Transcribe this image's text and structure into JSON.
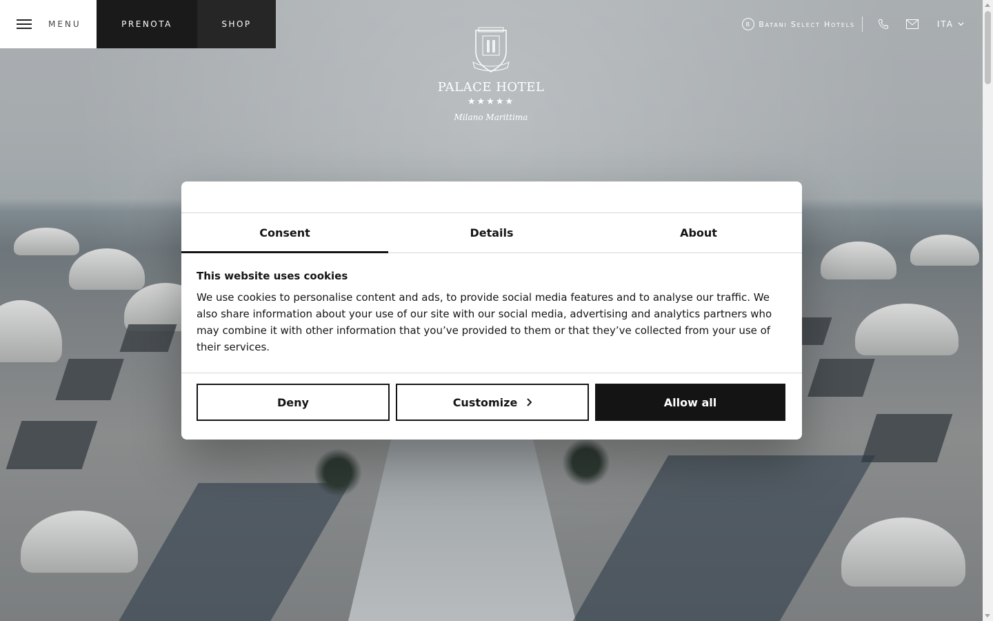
{
  "nav": {
    "menu_label": "MENU",
    "prenota_label": "PRENOTA",
    "shop_label": "SHOP",
    "batani_label": "Batani Select Hotels",
    "batani_icon": "circle-emblem-icon",
    "phone_icon": "phone-icon",
    "mail_icon": "mail-icon",
    "language": "ITA"
  },
  "logo": {
    "name": "PALACE HOTEL",
    "stars": "★★★★★",
    "place": "Milano Marittima"
  },
  "cookie_dialog": {
    "tabs": [
      {
        "label": "Consent",
        "active": true
      },
      {
        "label": "Details",
        "active": false
      },
      {
        "label": "About",
        "active": false
      }
    ],
    "title": "This website uses cookies",
    "text": "We use cookies to personalise content and ads, to provide social media features and to analyse our traffic. We also share information about your use of our site with our social media, advertising and analytics partners who may combine it with other information that you’ve provided to them or that they’ve collected from your use of their services.",
    "deny_label": "Deny",
    "customize_label": "Customize",
    "allow_label": "Allow all"
  },
  "colors": {
    "dark": "#141414",
    "nav_prenota": "#1a1a1a",
    "nav_shop": "#262626"
  }
}
